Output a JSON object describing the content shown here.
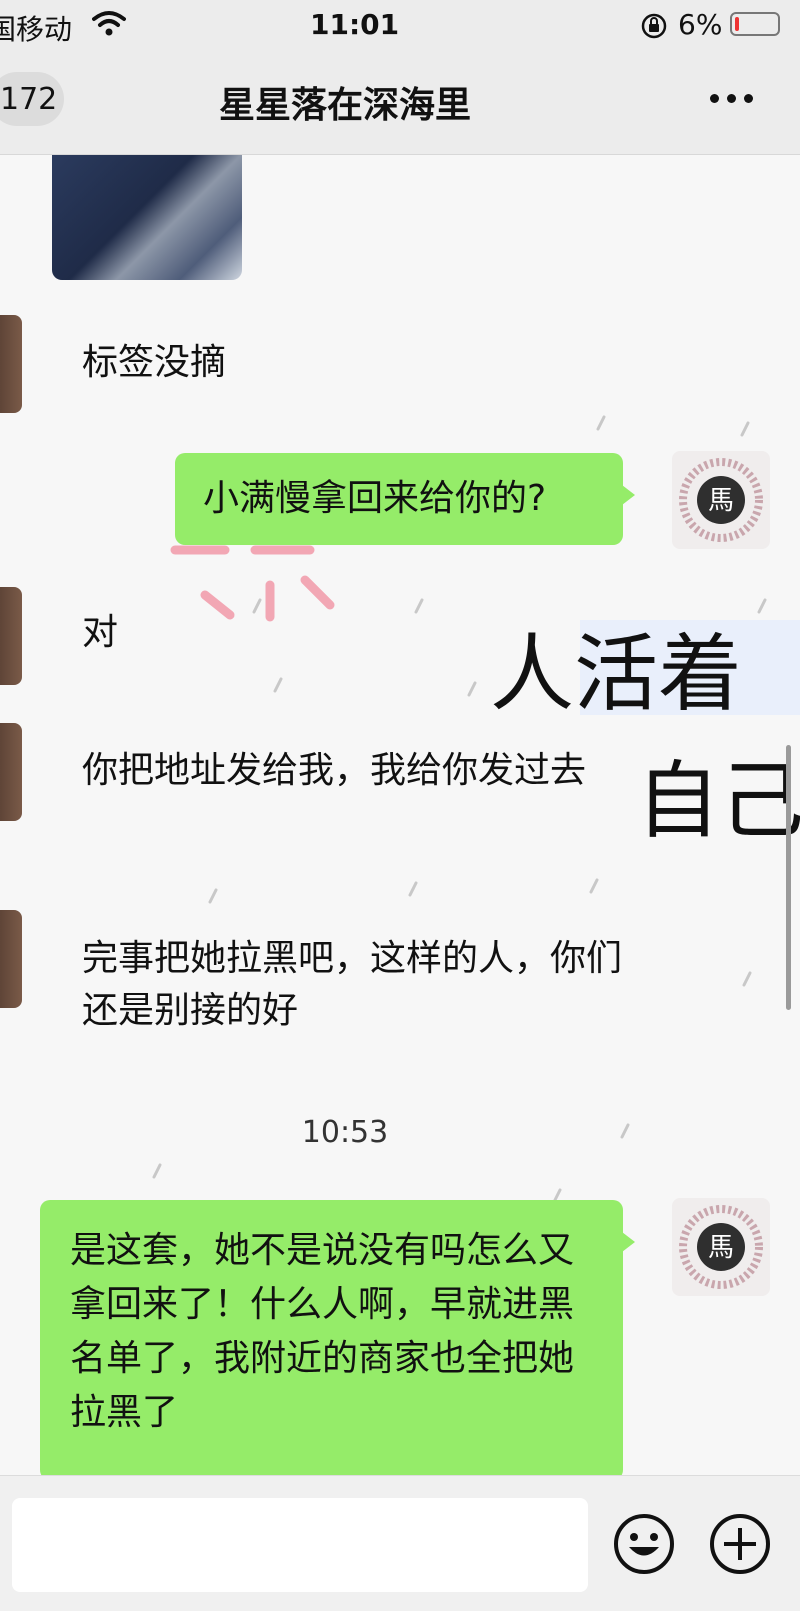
{
  "status_bar": {
    "carrier": "国移动",
    "time": "11:01",
    "battery_percent": "6%",
    "icons": [
      "wifi-icon",
      "orientation-lock-icon",
      "battery-icon"
    ]
  },
  "nav": {
    "back_count": "172",
    "title": "星星落在深海里",
    "more_icon": "more-icon"
  },
  "messages": [
    {
      "side": "left",
      "type": "image"
    },
    {
      "side": "left",
      "text": "标签没摘"
    },
    {
      "side": "right",
      "text": "小满慢拿回来给你的?"
    },
    {
      "side": "left",
      "text": "对"
    },
    {
      "side": "left",
      "text": "你把地址发给我，我给你发过去"
    },
    {
      "side": "left",
      "text": "完事把她拉黑吧，这样的人，你们还是别接的好"
    },
    {
      "type": "time",
      "text": "10:53"
    },
    {
      "side": "right",
      "text": "是这套，她不是说没有吗怎么又拿回来了！什么人啊，早就进黑名单了，我附近的商家也全把她拉黑了"
    }
  ],
  "wallpaper": {
    "text_line1": "人活着",
    "text_line2": "自己"
  },
  "avatar_right": {
    "char": "馬"
  },
  "input_bar": {
    "placeholder": "",
    "icons": [
      "emoji-icon",
      "plus-icon"
    ]
  },
  "colors": {
    "bubble_right": "#95ec69",
    "bars": "#ececec",
    "background": "#f7f7f7"
  }
}
